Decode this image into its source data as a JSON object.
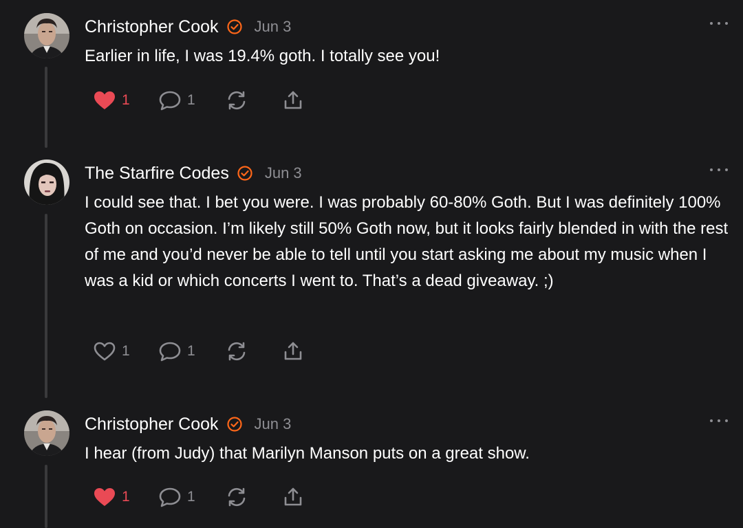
{
  "colors": {
    "background": "#19191b",
    "accent": "#ff6719",
    "like_red": "#ea4a55",
    "muted": "#8e8e93",
    "thread_line": "#3a3a3c"
  },
  "comments": [
    {
      "author": "Christopher Cook",
      "date": "Jun 3",
      "text": "Earlier in life, I was 19.4% goth. I totally see you!",
      "likes": "1",
      "liked": true,
      "replies": "1",
      "avatar": "man-portrait",
      "verified_icon": "verified-check-icon"
    },
    {
      "author": "The Starfire Codes",
      "date": "Jun 3",
      "text": "I could see that. I bet you were. I was probably 60-80% Goth. But I was definitely 100% Goth on occasion. I’m likely still 50% Goth now, but it looks fairly blended in with the rest of me and you’d never be able to tell until you start asking me about my music when I was a kid or which concerts I went to. That’s a dead giveaway. ;)",
      "likes": "1",
      "liked": false,
      "replies": "1",
      "avatar": "woman-portrait",
      "verified_icon": "verified-check-icon"
    },
    {
      "author": "Christopher Cook",
      "date": "Jun 3",
      "text": "I hear (from Judy) that Marilyn Manson puts on a great show.",
      "likes": "1",
      "liked": true,
      "replies": "1",
      "avatar": "man-portrait",
      "verified_icon": "verified-check-icon"
    }
  ]
}
